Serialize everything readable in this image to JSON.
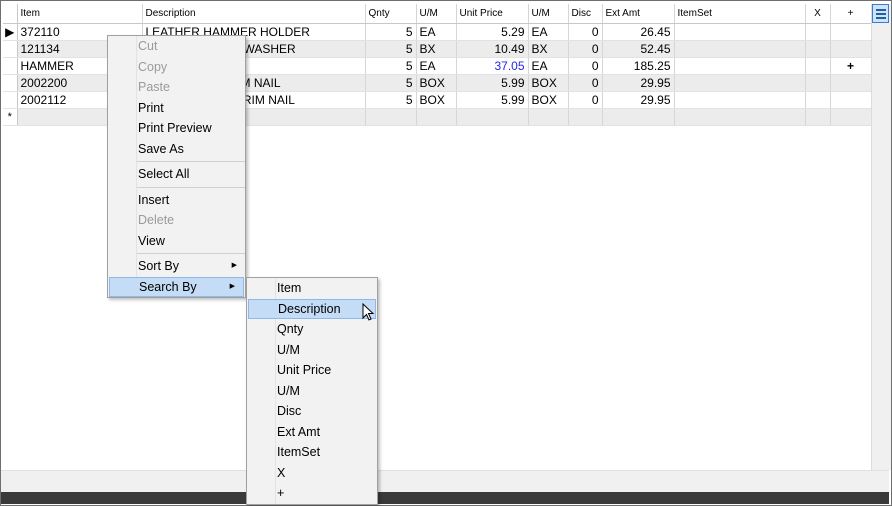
{
  "grid": {
    "headers": [
      "Item",
      "Description",
      "Qnty",
      "U/M",
      "Unit Price",
      "U/M",
      "Disc",
      "Ext Amt",
      "ItemSet",
      "X",
      "+"
    ],
    "rows": [
      {
        "item": "372110",
        "desc": "LEATHER HAMMER HOLDER",
        "qnty": "5",
        "um": "EA",
        "price": "5.29",
        "um2": "EA",
        "disc": "0",
        "ext": "26.45",
        "itemset": "",
        "x": "",
        "plus": ""
      },
      {
        "item": "121134",
        "desc": "WASHER",
        "qnty": "5",
        "um": "BX",
        "price": "10.49",
        "um2": "BX",
        "disc": "0",
        "ext": "52.45",
        "itemset": "",
        "x": "",
        "plus": ""
      },
      {
        "item": "HAMMER",
        "desc": "",
        "qnty": "5",
        "um": "EA",
        "price": "37.05",
        "um2": "EA",
        "disc": "0",
        "ext": "185.25",
        "itemset": "",
        "x": "",
        "plus": "+"
      },
      {
        "item": "2002200",
        "desc": "RIM NAIL",
        "qnty": "5",
        "um": "BOX",
        "price": "5.99",
        "um2": "BOX",
        "disc": "0",
        "ext": "29.95",
        "itemset": "",
        "x": "",
        "plus": ""
      },
      {
        "item": "2002112",
        "desc": "2\" TRIM NAIL",
        "qnty": "5",
        "um": "BOX",
        "price": "5.99",
        "um2": "BOX",
        "disc": "0",
        "ext": "29.95",
        "itemset": "",
        "x": "",
        "plus": ""
      }
    ],
    "new_row_marker": "*",
    "current_row_marker": "▶"
  },
  "context_menu": {
    "cut": "Cut",
    "copy": "Copy",
    "paste": "Paste",
    "print": "Print",
    "print_preview": "Print Preview",
    "save_as": "Save As",
    "select_all": "Select All",
    "insert": "Insert",
    "delete": "Delete",
    "view": "View",
    "sort_by": "Sort By",
    "search_by": "Search By"
  },
  "submenu": {
    "items": [
      "Item",
      "Description",
      "Qnty",
      "U/M",
      "Unit Price",
      "U/M",
      "Disc",
      "Ext Amt",
      "ItemSet",
      "X",
      "+"
    ],
    "highlighted": "Description"
  },
  "colors": {
    "highlight": "#c4dcf5",
    "price_link": "#2424e6"
  }
}
